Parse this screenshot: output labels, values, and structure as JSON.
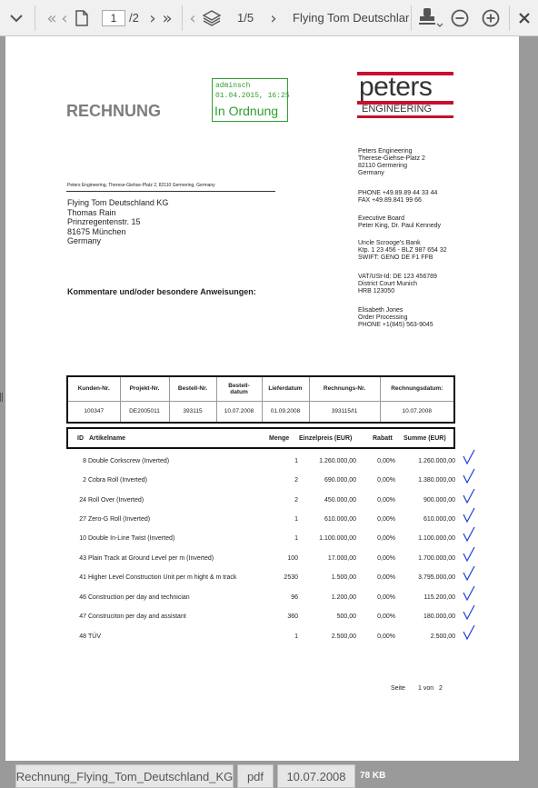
{
  "toolbar": {
    "current_page": "1",
    "total_pages": "/2",
    "layer_position": "1/5",
    "document_title": "Flying Tom Deutschland KG"
  },
  "invoice": {
    "title": "RECHNUNG",
    "stamp": {
      "user": "adminsch",
      "datetime": "01.04.2015, 16:25",
      "status": "In Ordnung"
    },
    "logo": {
      "name": "peters",
      "subtitle": "ENGINEERING"
    },
    "sender_line": "Peters Engineering, Therese-Giehse-Platz 2, 82110 Germering, Germany",
    "recipient": [
      "Flying Tom Deutschland KG",
      "Thomas Rain",
      "Prinzregentenstr. 15",
      "81675 München",
      "Germany"
    ],
    "comments_label": "Kommentare und/oder besondere Anweisungen:",
    "company": {
      "address": [
        "Peters Engineering",
        "Therese-Giehse-Platz 2",
        "82110 Germering",
        "Germany"
      ],
      "contact": [
        "PHONE  +49.89.89 44 33 44",
        "FAX       +49.89.841 99 66"
      ],
      "board": [
        "Executive Board",
        "Peter King, Dr. Paul Kennedy"
      ],
      "bank": [
        "Uncle Scrooge's Bank",
        "Ktp. 1 23 456 - BLZ 987 654 32",
        "SWIFT: GENO DE F1 FFB"
      ],
      "legal": [
        "VAT/USt-Id: DE 123 456789",
        "District Court Munich",
        "HRB 123050"
      ],
      "processor": [
        "Elisabeth Jones",
        "Order Processing",
        "PHONE  +1(845) 563-9045"
      ]
    },
    "meta_headers": [
      "Kunden-Nr.",
      "Projekt-Nr.",
      "Bestell-Nr.",
      "Bestell-\ndatum",
      "Lieferdatum",
      "Rechnungs-Nr.",
      "Rechnungsdatum:"
    ],
    "meta_values": [
      "100347",
      "DE2005011",
      "393115",
      "10.07.2008",
      "01.09.2008",
      "393115/I1",
      "10.07.2008"
    ],
    "item_headers": {
      "id": "ID",
      "name": "Artikelname",
      "qty": "Menge",
      "price": "Einzelpreis (EUR)",
      "discount": "Rabatt",
      "total": "Summe (EUR)"
    },
    "items": [
      {
        "id": "8",
        "name": "Double Corkscrew (Inverted)",
        "qty": "1",
        "price": "1.260.000,00",
        "discount": "0,00%",
        "total": "1.260.000,00"
      },
      {
        "id": "2",
        "name": "Cobra Roll (Inverted)",
        "qty": "2",
        "price": "690.000,00",
        "discount": "0,00%",
        "total": "1.380.000,00"
      },
      {
        "id": "24",
        "name": "Roll Over (Inverted)",
        "qty": "2",
        "price": "450.000,00",
        "discount": "0,00%",
        "total": "900.000,00"
      },
      {
        "id": "27",
        "name": "Zero-G Roll (Inverted)",
        "qty": "1",
        "price": "610.000,00",
        "discount": "0,00%",
        "total": "610.000,00"
      },
      {
        "id": "10",
        "name": "Double In-Line Twist (Inverted)",
        "qty": "1",
        "price": "1.100.000,00",
        "discount": "0,00%",
        "total": "1.100.000,00"
      },
      {
        "id": "43",
        "name": "Plain Track at Ground Level per m (Inverted)",
        "qty": "100",
        "price": "17.000,00",
        "discount": "0,00%",
        "total": "1.700.000,00"
      },
      {
        "id": "41",
        "name": "Higher Level Construction Unit per m hight & m track",
        "qty": "2530",
        "price": "1.500,00",
        "discount": "0,00%",
        "total": "3.795.000,00"
      },
      {
        "id": "46",
        "name": "Construction per day and technician",
        "qty": "96",
        "price": "1.200,00",
        "discount": "0,00%",
        "total": "115.200,00"
      },
      {
        "id": "47",
        "name": "Construciton per day and assistant",
        "qty": "360",
        "price": "500,00",
        "discount": "0,00%",
        "total": "180.000,00"
      },
      {
        "id": "48",
        "name": "TÜV",
        "qty": "1",
        "price": "2.500,00",
        "discount": "0,00%",
        "total": "2.500,00"
      }
    ],
    "pagination": {
      "label": "Seite",
      "text": "1 von   2"
    }
  },
  "footer": {
    "filename": "Rechnung_Flying_Tom_Deutschland_KG",
    "filetype": "pdf",
    "date": "10.07.2008",
    "filesize": "78 KB"
  },
  "colors": {
    "stamp_green": "#2e9e2e",
    "logo_red": "#c8102e",
    "check_blue": "#1a3fd6"
  }
}
